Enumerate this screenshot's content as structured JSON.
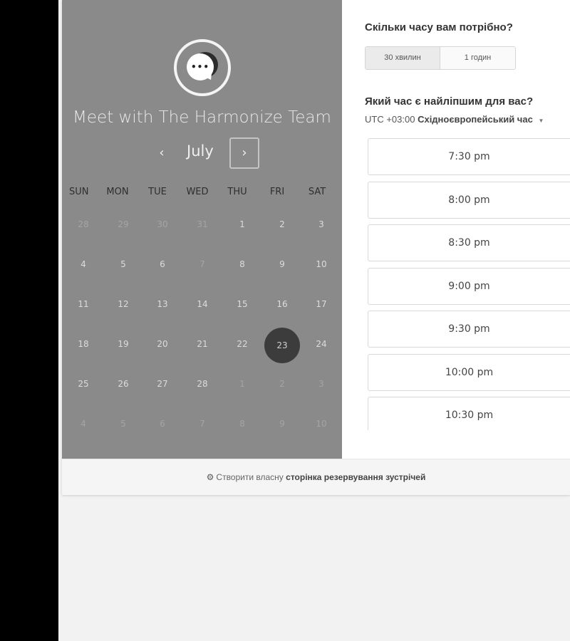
{
  "organizer": {
    "title": "Meet with The Harmonize Team",
    "avatar_glyph": "•••"
  },
  "calendar": {
    "month": "July",
    "prev_glyph": "‹",
    "next_glyph": "›",
    "weekdays": [
      "SUN",
      "MON",
      "TUE",
      "WED",
      "THU",
      "FRI",
      "SAT"
    ],
    "weeks": [
      [
        "28",
        "29",
        "30",
        "31",
        "1",
        "2",
        "3"
      ],
      [
        "4",
        "5",
        "6",
        "7",
        "8",
        "9",
        "10"
      ],
      [
        "11",
        "12",
        "13",
        "14",
        "15",
        "16",
        "17"
      ],
      [
        "18",
        "19",
        "20",
        "21",
        "22",
        "23",
        "24"
      ],
      [
        "25",
        "26",
        "27",
        "28",
        "1",
        "2",
        "3"
      ],
      [
        "4",
        "5",
        "6",
        "7",
        "8",
        "9",
        "10"
      ]
    ],
    "selected_day": "23"
  },
  "duration": {
    "question": "Скільки часу вам потрібно?",
    "options": [
      "30 хвилин",
      "1 годин"
    ],
    "selected": "30 хвилин"
  },
  "time": {
    "question": "Який час є найліпшим для вас?",
    "timezone_prefix": "UTC +03:00",
    "timezone_name": "Східноєвропейський час",
    "slots": [
      "7:30 pm",
      "8:00 pm",
      "8:30 pm",
      "9:00 pm",
      "9:30 pm",
      "10:00 pm",
      "10:30 pm"
    ]
  },
  "footer": {
    "prefix": "Створити власну",
    "link": "сторінка резервування зустрічей"
  },
  "colors": {
    "left_panel": "#8a8a8a",
    "selected_day": "#3c3c3c",
    "page_bg": "#f2f2f2"
  }
}
